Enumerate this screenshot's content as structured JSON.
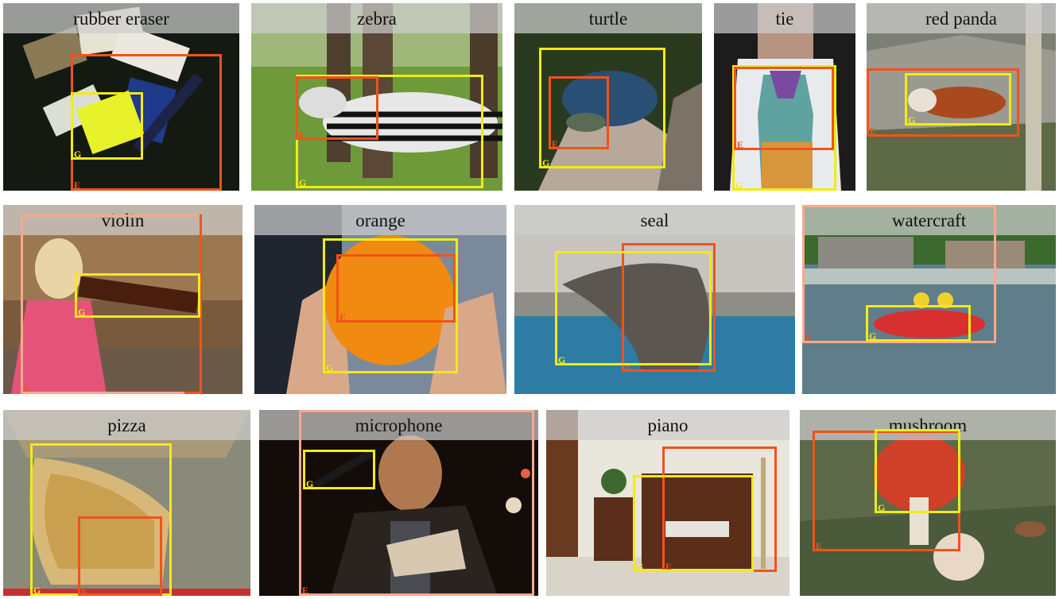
{
  "tiles": [
    {
      "label": "rubber eraser",
      "gt_tag": "G",
      "est_tag": "E"
    },
    {
      "label": "zebra",
      "gt_tag": "G",
      "est_tag": "E"
    },
    {
      "label": "turtle",
      "gt_tag": "G",
      "est_tag": "E"
    },
    {
      "label": "tie",
      "gt_tag": "G",
      "est_tag": "E"
    },
    {
      "label": "red panda",
      "gt_tag": "G",
      "est_tag": "E"
    },
    {
      "label": "violin",
      "gt_tag": "G",
      "est_tag": "E"
    },
    {
      "label": "orange",
      "gt_tag": "G",
      "est_tag": "E"
    },
    {
      "label": "seal",
      "gt_tag": "G",
      "est_tag": "E"
    },
    {
      "label": "watercraft",
      "gt_tag": "G",
      "est_tag": "E"
    },
    {
      "label": "pizza",
      "gt_tag": "G",
      "est_tag": "E"
    },
    {
      "label": "microphone",
      "gt_tag": "G",
      "est_tag": "E"
    },
    {
      "label": "piano",
      "gt_tag": "G",
      "est_tag": "E"
    },
    {
      "label": "mushroom",
      "gt_tag": "G",
      "est_tag": "E"
    }
  ],
  "colors": {
    "ground_truth_box": "#f2ea16",
    "estimate_box": "#f0531a"
  }
}
